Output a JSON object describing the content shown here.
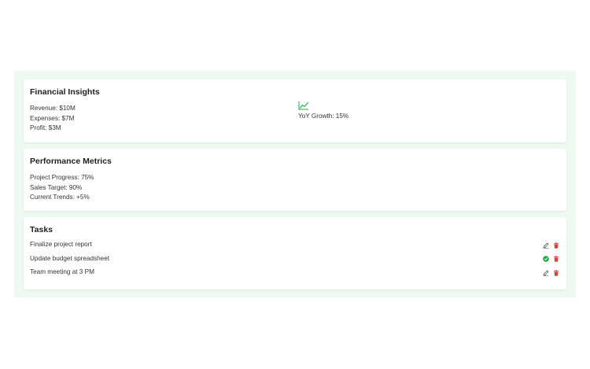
{
  "financial": {
    "title": "Financial Insights",
    "revenue": "Revenue: $10M",
    "expenses": "Expenses: $7M",
    "profit": "Profit: $3M",
    "growth": "YoY Growth: 15%",
    "growth_icon": "trending-up-icon"
  },
  "performance": {
    "title": "Performance Metrics",
    "project_progress": "Project Progress: 75%",
    "sales_target": "Sales Target: 90%",
    "current_trends": "Current Trends: +5%"
  },
  "tasks": {
    "title": "Tasks",
    "items": [
      {
        "label": "Finalize project report",
        "primary_icon": "edit-icon",
        "secondary_icon": "trash-icon"
      },
      {
        "label": "Update budget spreadsheet",
        "primary_icon": "check-circle-icon",
        "secondary_icon": "trash-icon"
      },
      {
        "label": "Team meeting at 3 PM",
        "primary_icon": "edit-icon",
        "secondary_icon": "trash-icon"
      }
    ]
  },
  "colors": {
    "panel_background": "#eefaf1",
    "accent_green": "#22a447",
    "delete_red": "#e53935",
    "edit_gray": "#555555"
  }
}
